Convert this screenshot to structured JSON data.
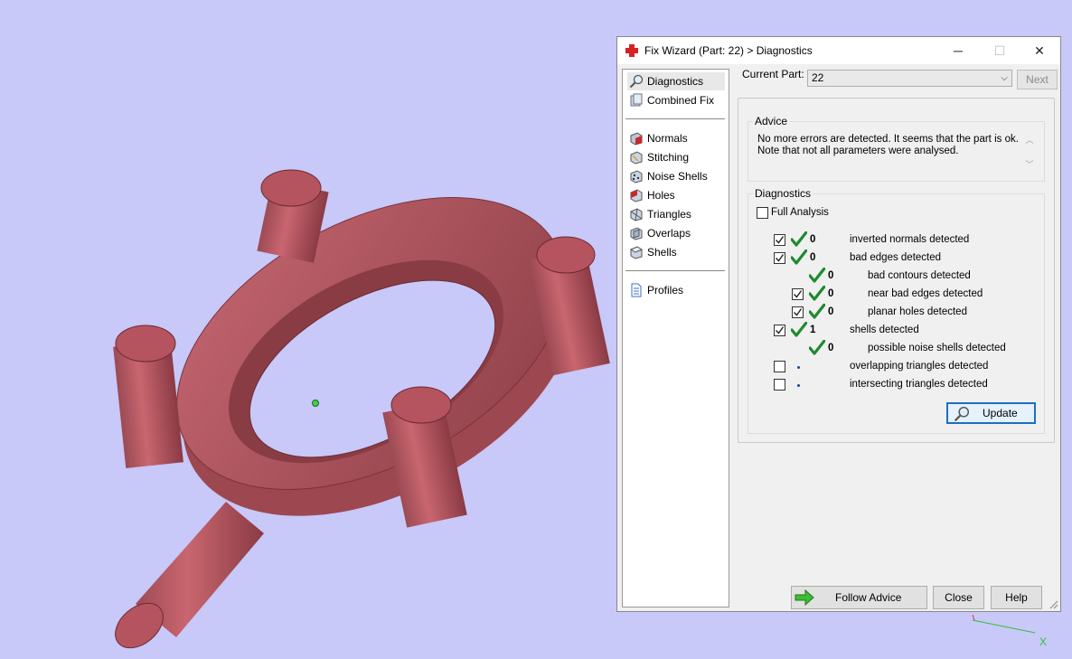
{
  "window": {
    "title": "Fix Wizard (Part: 22) > Diagnostics",
    "minimize": "─",
    "maximize": "☐",
    "close": "✕"
  },
  "sidebar": {
    "group1": [
      {
        "label": "Diagnostics",
        "icon": "magnifier-icon",
        "selected": true
      },
      {
        "label": "Combined Fix",
        "icon": "combined-fix-icon"
      }
    ],
    "group2": [
      {
        "label": "Normals",
        "icon": "normals-icon"
      },
      {
        "label": "Stitching",
        "icon": "stitching-icon"
      },
      {
        "label": "Noise Shells",
        "icon": "noise-shells-icon"
      },
      {
        "label": "Holes",
        "icon": "holes-icon"
      },
      {
        "label": "Triangles",
        "icon": "triangles-icon"
      },
      {
        "label": "Overlaps",
        "icon": "overlaps-icon"
      },
      {
        "label": "Shells",
        "icon": "shells-icon"
      }
    ],
    "group3": [
      {
        "label": "Profiles",
        "icon": "document-icon"
      }
    ]
  },
  "current_part": {
    "label": "Current Part:",
    "value": "22",
    "next_label": "Next"
  },
  "advice": {
    "title": "Advice",
    "line1": "No more errors are detected. It seems that the part is ok.",
    "line2": "Note that not all parameters were analysed."
  },
  "diagnostics": {
    "title": "Diagnostics",
    "full_analysis_label": "Full Analysis",
    "full_analysis_checked": false,
    "rows": [
      {
        "checkbox": true,
        "checked": true,
        "status": "ok",
        "count": "0",
        "label": "inverted normals detected",
        "indent": 0
      },
      {
        "checkbox": true,
        "checked": true,
        "status": "ok",
        "count": "0",
        "label": "bad edges detected",
        "indent": 0
      },
      {
        "checkbox": false,
        "checked": false,
        "status": "ok",
        "count": "0",
        "label": "bad contours detected",
        "indent": 1
      },
      {
        "checkbox": true,
        "checked": true,
        "status": "ok",
        "count": "0",
        "label": "near bad edges detected",
        "indent": 1
      },
      {
        "checkbox": true,
        "checked": true,
        "status": "ok",
        "count": "0",
        "label": "planar holes detected",
        "indent": 1
      },
      {
        "checkbox": true,
        "checked": true,
        "status": "ok",
        "count": "1",
        "label": "shells detected",
        "indent": 0
      },
      {
        "checkbox": false,
        "checked": false,
        "status": "ok",
        "count": "0",
        "label": "possible noise shells detected",
        "indent": 1
      },
      {
        "checkbox": true,
        "checked": false,
        "status": "none",
        "count": "",
        "label": "overlapping triangles detected",
        "indent": 0
      },
      {
        "checkbox": true,
        "checked": false,
        "status": "none",
        "count": "",
        "label": "intersecting triangles detected",
        "indent": 0
      }
    ],
    "update_label": "Update"
  },
  "footer": {
    "follow_advice_label": "Follow Advice",
    "close_label": "Close",
    "help_label": "Help"
  },
  "colors": {
    "background": "#c8c8f9",
    "part": "#b5545f",
    "check_green": "#1e8a2e"
  }
}
